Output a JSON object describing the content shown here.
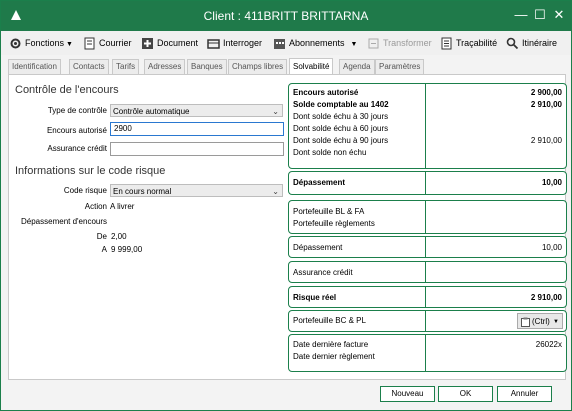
{
  "window": {
    "title": "Client : 411BRITT BRITTARNA",
    "minimize": "—",
    "maximize": "☐",
    "close": "✕"
  },
  "toolbar": {
    "fonctions": "Fonctions",
    "courrier": "Courrier",
    "document": "Document",
    "interroger": "Interroger",
    "abonnements": "Abonnements",
    "transformer": "Transformer",
    "tracabilite": "Traçabilité",
    "itineraire": "Itinéraire"
  },
  "tabs": [
    "Identification",
    "Contacts",
    "Tarifs",
    "Adresses",
    "Banques",
    "Champs libres",
    "Solvabilité",
    "Agenda",
    "Paramètres"
  ],
  "active_tab": "Solvabilité",
  "controle": {
    "heading": "Contrôle de l'encours",
    "type_label": "Type de contrôle",
    "type_value": "Contrôle automatique",
    "encours_label": "Encours autorisé",
    "encours_value": "2900",
    "assurance_label": "Assurance crédit",
    "assurance_value": ""
  },
  "risque": {
    "heading": "Informations sur le code risque",
    "code_label": "Code risque",
    "code_value": "En cours normal",
    "action_label": "Action",
    "action_value": "A livrer",
    "depassement_label": "Dépassement d'encours",
    "de_label": "De",
    "de_value": "2,00",
    "a_label": "A",
    "a_value": "9 999,00"
  },
  "right": {
    "encours_autorise": "Encours autorisé",
    "encours_autorise_val": "2 900,00",
    "solde_comptable": "Solde comptable au 1402",
    "solde_comptable_val": "2 910,00",
    "echu30": "Dont solde échu à 30 jours",
    "echu60": "Dont solde échu à 60 jours",
    "echu90": "Dont solde échu à 90 jours",
    "echu90_val": "2 910,00",
    "non_echu": "Dont solde non échu",
    "depassement_b": "Dépassement",
    "depassement_b_val": "10,00",
    "portefeuille_bl": "Portefeuille BL & FA",
    "portefeuille_reg": "Portefeuille règlements",
    "depassement": "Dépassement",
    "depassement_val": "10,00",
    "assurance": "Assurance crédit",
    "risque_reel": "Risque réel",
    "risque_reel_val": "2 910,00",
    "portefeuille_bc": "Portefeuille BC & PL",
    "ctrl_label": "(Ctrl)",
    "date_facture": "Date dernière facture",
    "date_facture_val": "26022x",
    "date_reglement": "Date dernier règlement"
  },
  "buttons": {
    "nouveau": "Nouveau",
    "ok": "OK",
    "annuler": "Annuler"
  },
  "colors": {
    "accent": "#1f7a4a",
    "border": "#1b7f4b"
  }
}
